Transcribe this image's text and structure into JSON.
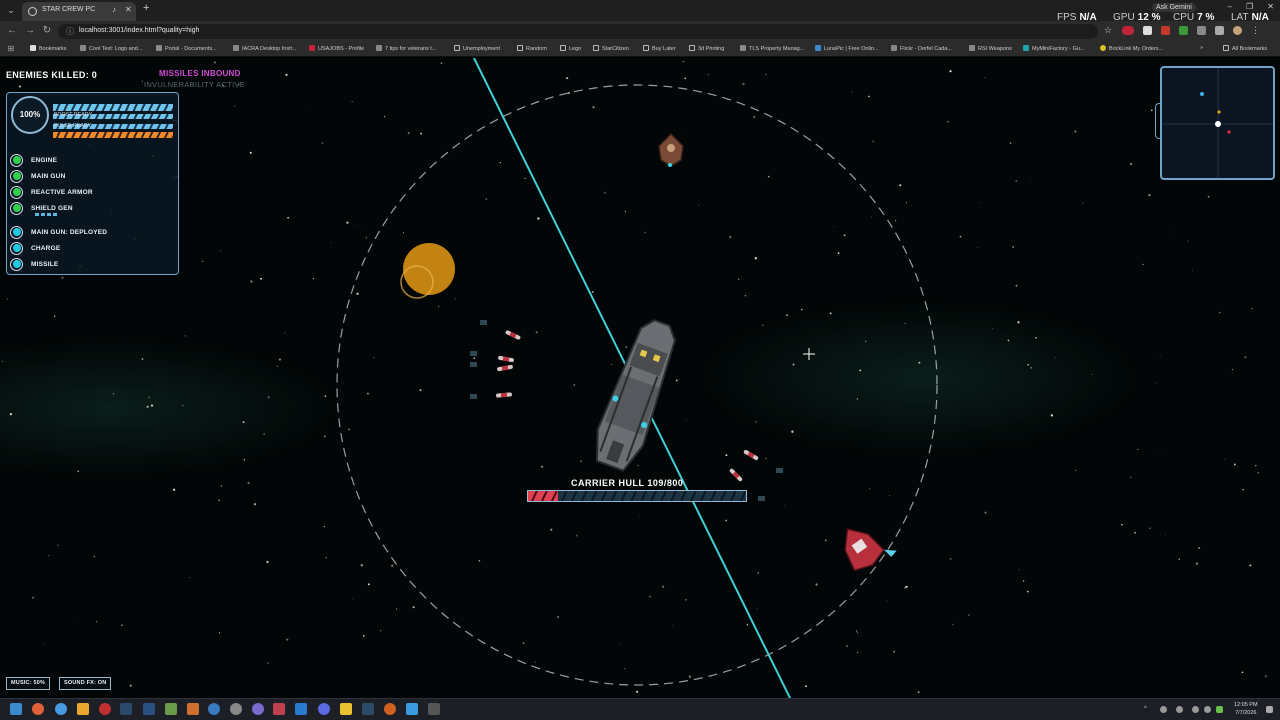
{
  "browser": {
    "tab_title": "STAR CREW PC",
    "url": "localhost:3001/index.html?quality=high",
    "ask_gemini": "Ask Gemini",
    "bookmarks": [
      "Bookmarks",
      "Cool Text: Logo and...",
      "Portal - Documents...",
      "IACRA Desktop Instr...",
      "USAJOBS - Profile",
      "7 tips for veterans t...",
      "Unemployment",
      "Random",
      "Lego",
      "StarCitizen",
      "Buy Later",
      "3d Printing",
      "TLS Property Manag...",
      "LunaPic | Free Onlin...",
      "Flickr - Derfel Cada...",
      "RSI Weapons",
      "MyMiniFactory - Gu...",
      "BrickLink My Orders..."
    ],
    "all_bookmarks": "All Bookmarks",
    "bookmarks_more": "»"
  },
  "perf": {
    "fps_label": "FPS",
    "fps_value": "N/A",
    "gpu_label": "GPU",
    "gpu_value": "12 %",
    "cpu_label": "CPU",
    "cpu_value": "7 %",
    "lat_label": "LAT",
    "lat_value": "N/A"
  },
  "hud": {
    "enemies_killed": "ENEMIES KILLED: 0",
    "missiles_inbound": "MISSILES INBOUND",
    "invulnerability": "INVULNERABILITY ACTIVE",
    "shield_pct": "100%",
    "boost_label": "BOOST READY",
    "pulse_label": "PULSE READY",
    "systems": [
      {
        "label": "ENGINE",
        "status": "green"
      },
      {
        "label": "MAIN GUN",
        "status": "green"
      },
      {
        "label": "REACTIVE ARMOR",
        "status": "green"
      },
      {
        "label": "SHIELD GEN",
        "status": "green"
      }
    ],
    "weapons": [
      {
        "label": "MAIN GUN: DEPLOYED",
        "status": "cyan"
      },
      {
        "label": "CHARGE",
        "status": "cyan"
      },
      {
        "label": "MISSILE",
        "status": "cyan"
      }
    ],
    "carrier_label": "CARRIER HULL 109/800",
    "carrier_hull_current": 109,
    "carrier_hull_max": 800,
    "music_button": "MUSIC: 50%",
    "sound_button": "SOUND FX: ON"
  },
  "taskbar": {
    "time": "12:05 PM",
    "date": "7/7/2026"
  },
  "colors": {
    "hud_border": "#6fa3c7",
    "boost_bar": "#6ec3ef",
    "pulse_bar": "#ef8a2a",
    "system_ok": "#33d04a",
    "weapon_ready": "#1ccbe0",
    "missiles_text": "#d14cd6",
    "hull_bar": "#e04050",
    "laser": "#3fd0d8"
  }
}
